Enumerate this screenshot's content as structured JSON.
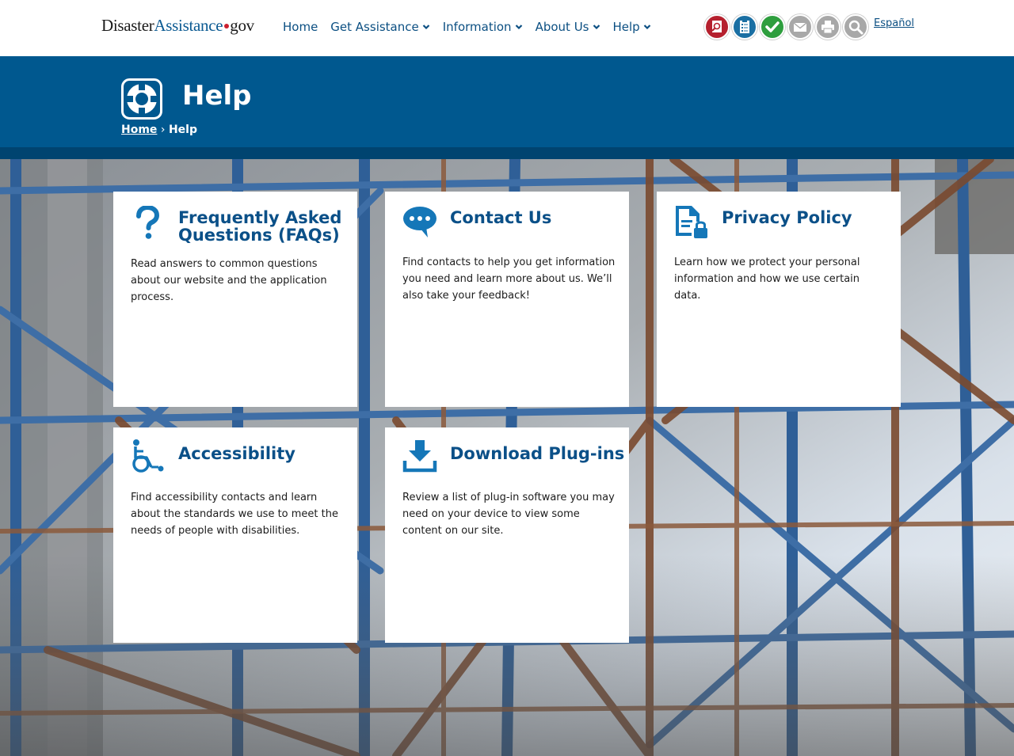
{
  "header": {
    "logo": {
      "disaster": "Disaster",
      "assistance": "Assistance",
      "gov": "gov"
    },
    "nav": [
      {
        "label": "Home",
        "has_dropdown": false
      },
      {
        "label": "Get Assistance",
        "has_dropdown": true
      },
      {
        "label": "Information",
        "has_dropdown": true
      },
      {
        "label": "About Us",
        "has_dropdown": true
      },
      {
        "label": "Help",
        "has_dropdown": true
      }
    ],
    "tools": [
      {
        "icon": "find-assistance-icon",
        "color": "#b5202e"
      },
      {
        "icon": "clipboard-checklist-icon",
        "color": "#1a6fa3"
      },
      {
        "icon": "check-status-icon",
        "color": "#2e9e3e"
      },
      {
        "icon": "email-icon",
        "color": "#a8a8a8"
      },
      {
        "icon": "print-icon",
        "color": "#a8a8a8"
      },
      {
        "icon": "search-icon",
        "color": "#a8a8a8"
      }
    ],
    "language_link": "Español"
  },
  "banner": {
    "title": "Help",
    "icon": "life-preserver-icon",
    "breadcrumb": {
      "home": "Home",
      "separator": "›",
      "current": "Help"
    },
    "color": "#00588f"
  },
  "cards": [
    {
      "id": "faq",
      "icon": "question-mark-icon",
      "title": "Frequently Asked Questions (FAQs)",
      "description": "Read answers to common questions about our website and the application process."
    },
    {
      "id": "contact",
      "icon": "chat-bubble-icon",
      "title": "Contact Us",
      "description": "Find contacts to help you get information you need and learn more about us. We’ll also take your feedback!"
    },
    {
      "id": "privacy",
      "icon": "document-lock-icon",
      "title": "Privacy Policy",
      "description": "Learn how we protect your personal information and how we use certain data."
    },
    {
      "id": "accessibility",
      "icon": "wheelchair-icon",
      "title": "Accessibility",
      "description": "Find accessibility contacts and learn about the standards we use to meet the needs of people with disabilities."
    },
    {
      "id": "plugins",
      "icon": "download-icon",
      "title": "Download Plug-ins",
      "description": "Review a list of plug-in software you may need on your device to view some content on our site."
    }
  ]
}
